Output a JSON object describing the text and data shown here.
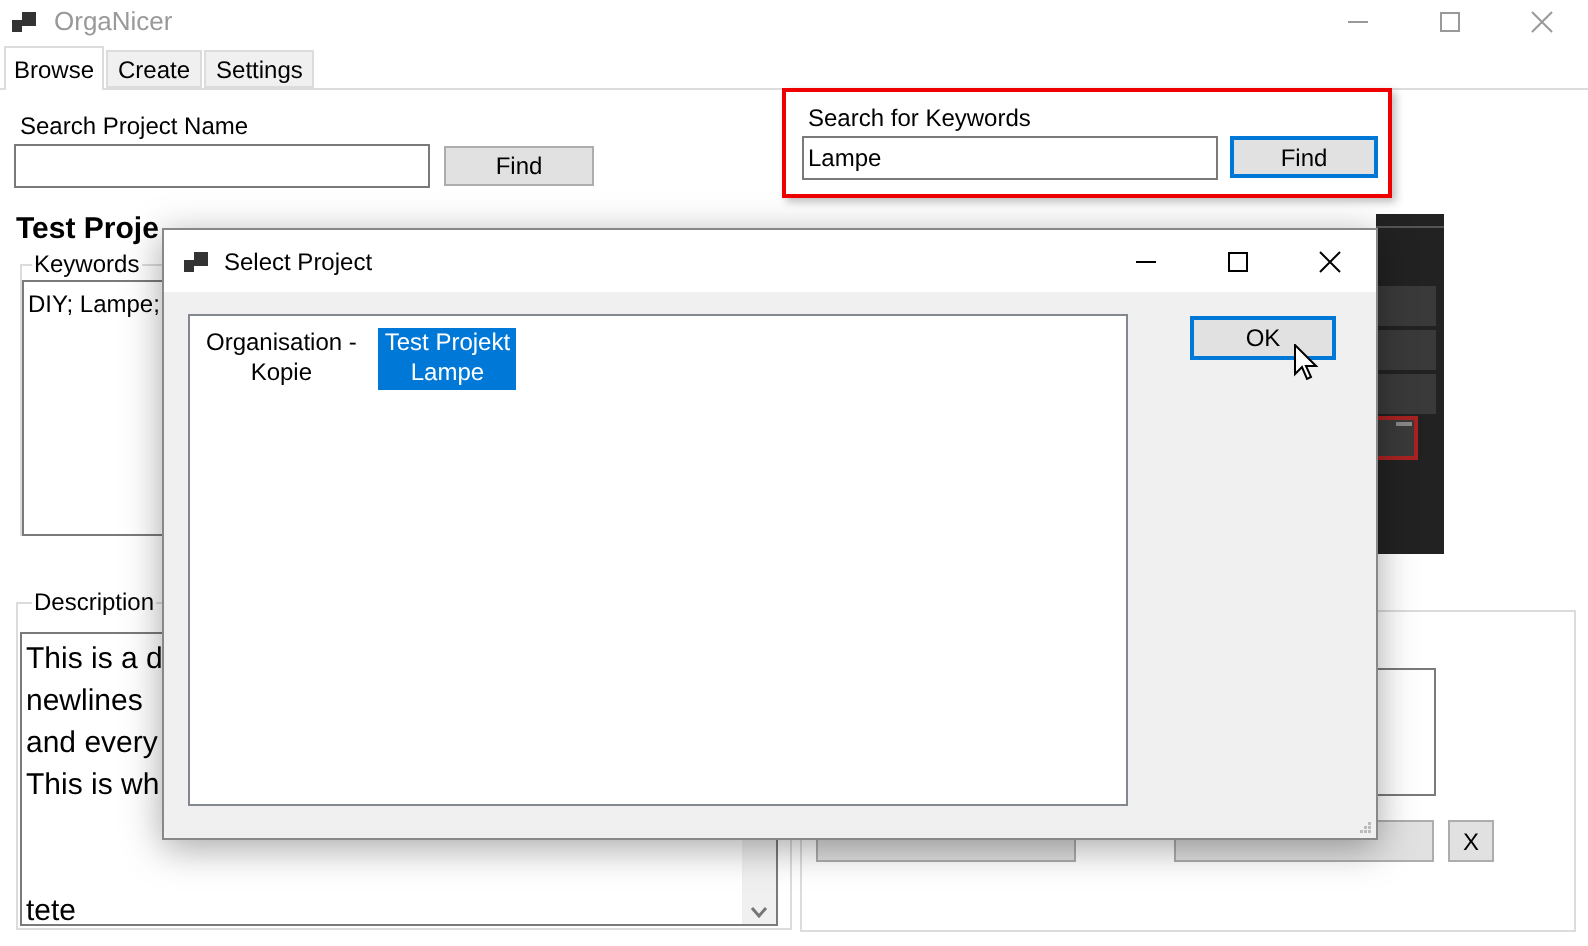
{
  "window": {
    "title": "OrgaNicer"
  },
  "tabs": [
    {
      "label": "Browse",
      "selected": true
    },
    {
      "label": "Create",
      "selected": false
    },
    {
      "label": "Settings",
      "selected": false
    }
  ],
  "name_search": {
    "label": "Search Project Name",
    "button": "Find"
  },
  "keyword_search": {
    "label": "Search for Keywords",
    "value": "Lampe",
    "button": "Find",
    "highlighted": true
  },
  "project": {
    "title": "Test Proje",
    "keywords_label": "Keywords",
    "keywords": "DIY; Lampe;",
    "description_label": "Description",
    "description": "This is a d\nnewlines\nand every\nThis is wh\n\n\ntete"
  },
  "actions": {
    "remove_button": "X"
  },
  "dialog": {
    "title": "Select Project",
    "items": [
      {
        "label": "Organisation -\nKopie",
        "selected": false
      },
      {
        "label": "Test Projekt\nLampe",
        "selected": true
      }
    ],
    "ok": "OK"
  }
}
